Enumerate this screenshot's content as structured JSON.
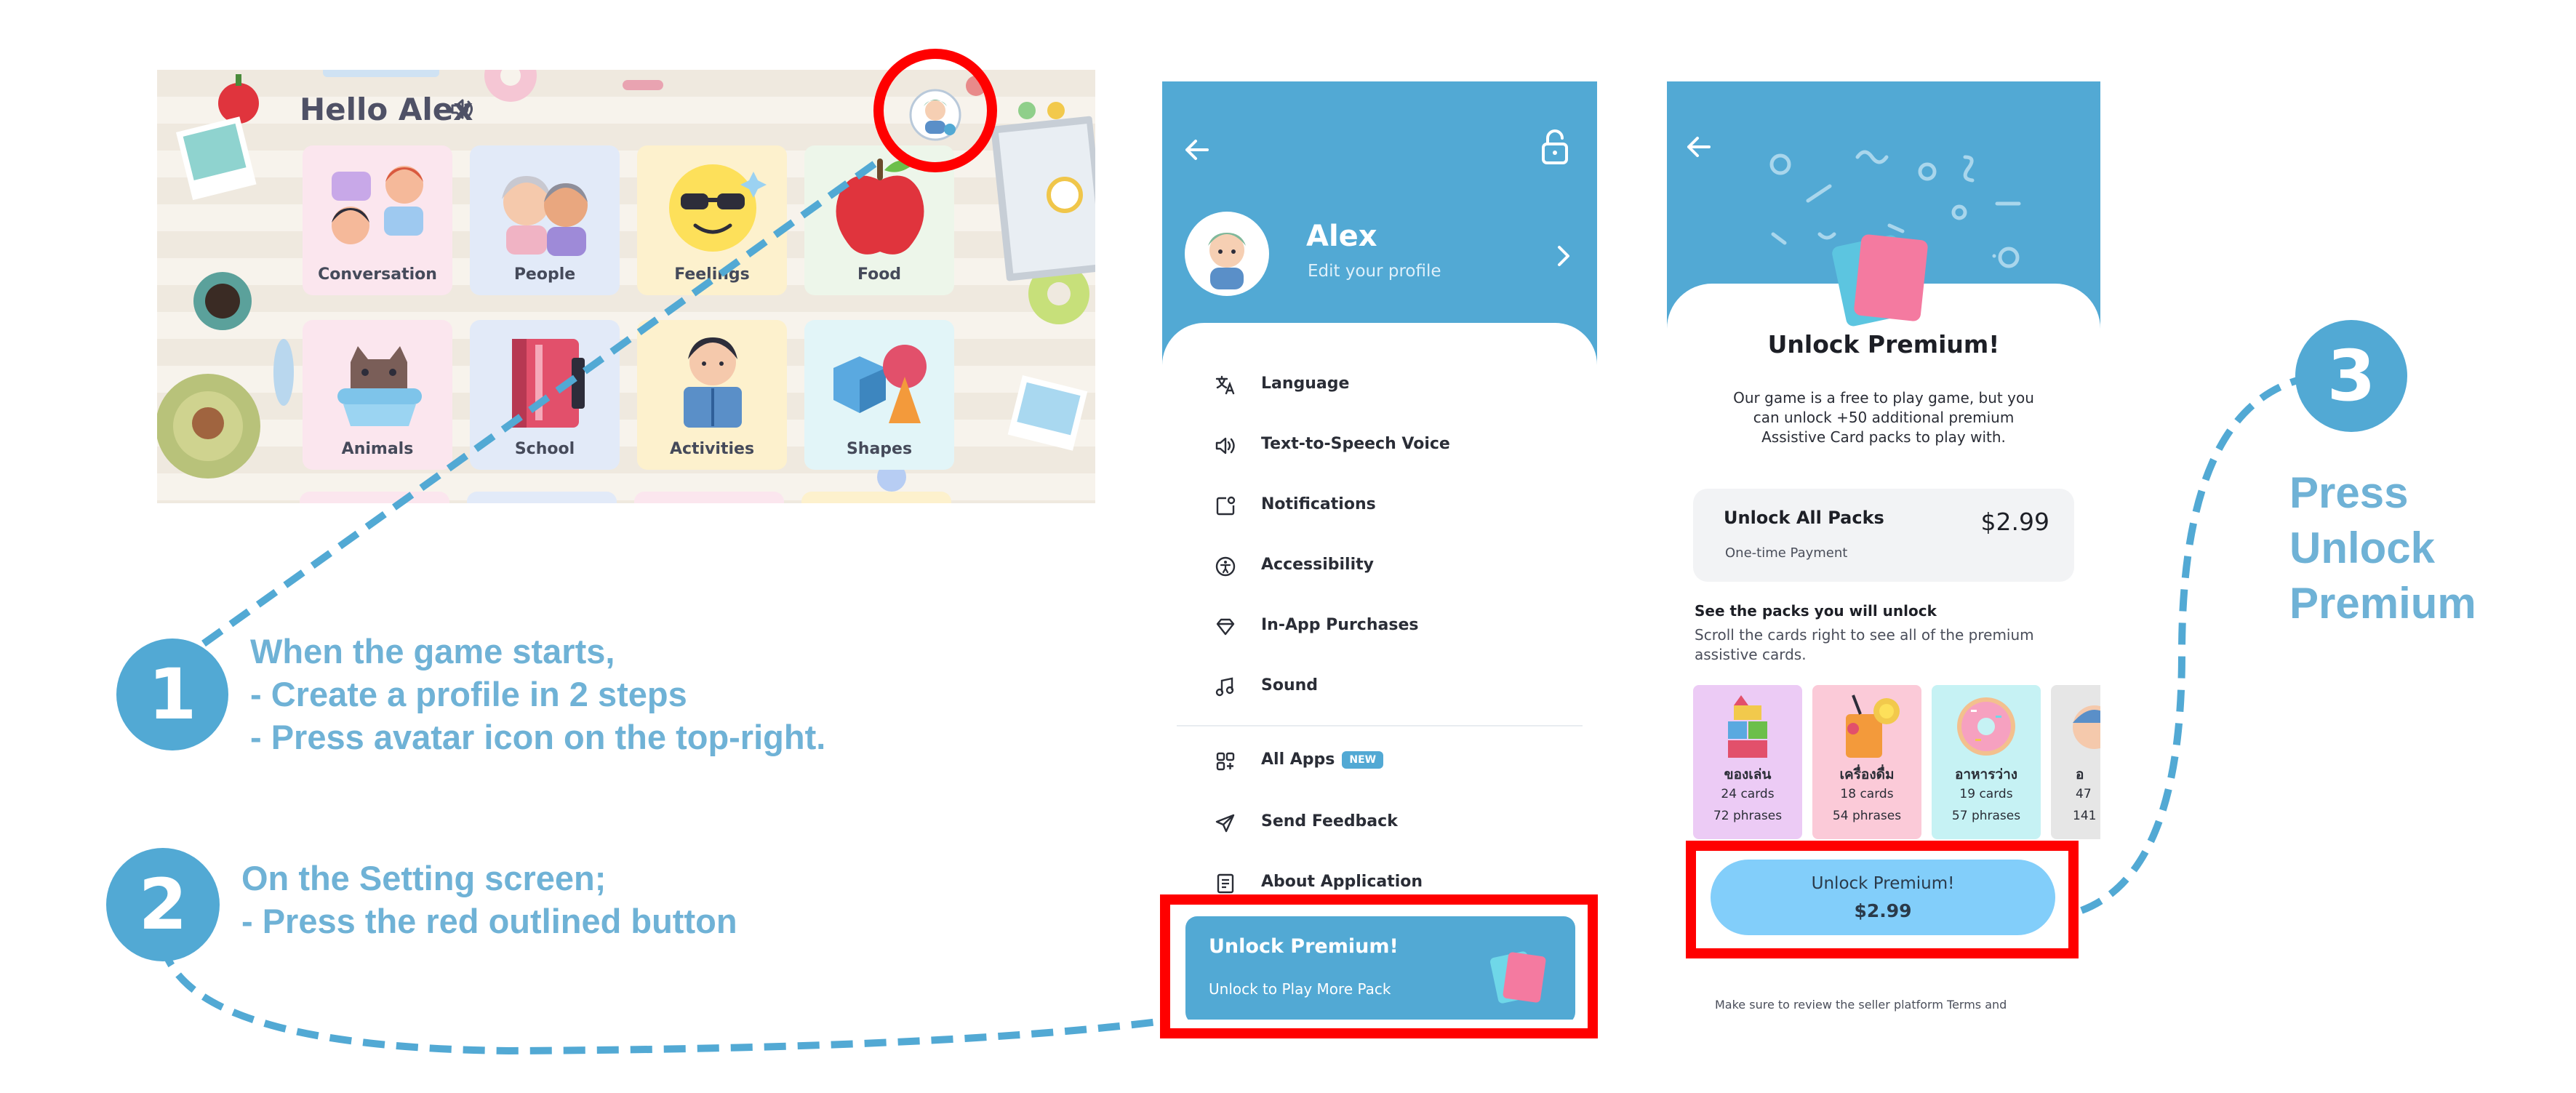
{
  "home": {
    "greeting": "Hello Alex",
    "tiles": [
      {
        "label": "Conversation",
        "color": "#fbe6ee"
      },
      {
        "label": "People",
        "color": "#e2eaf8"
      },
      {
        "label": "Feelings",
        "color": "#fdf1cd"
      },
      {
        "label": "Food",
        "color": "#edf6ea"
      },
      {
        "label": "Animals",
        "color": "#fbe6ee"
      },
      {
        "label": "School",
        "color": "#e2eaf8"
      },
      {
        "label": "Activities",
        "color": "#fdf1cd"
      },
      {
        "label": "Shapes",
        "color": "#e2f5f8"
      }
    ]
  },
  "settings": {
    "profile_name": "Alex",
    "profile_sub": "Edit your profile",
    "menu": [
      {
        "label": "Language",
        "icon": "translate-icon"
      },
      {
        "label": "Text-to-Speech Voice",
        "icon": "speaker-icon"
      },
      {
        "label": "Notifications",
        "icon": "notification-icon"
      },
      {
        "label": "Accessibility",
        "icon": "accessibility-icon"
      },
      {
        "label": "In-App Purchases",
        "icon": "diamond-icon"
      },
      {
        "label": "Sound",
        "icon": "music-icon"
      }
    ],
    "menu2": [
      {
        "label": "All Apps",
        "icon": "apps-icon",
        "badge": "NEW"
      },
      {
        "label": "Send Feedback",
        "icon": "send-icon"
      },
      {
        "label": "About Application",
        "icon": "document-icon"
      }
    ],
    "banner_title": "Unlock Premium!",
    "banner_sub": "Unlock to Play More Pack"
  },
  "premium": {
    "title": "Unlock Premium!",
    "description": "Our game is a free to play game, but you can unlock +50 additional premium Assistive Card packs to play with.",
    "offer_title": "Unlock All Packs",
    "offer_sub": "One-time Payment",
    "price": "$2.99",
    "see_title": "See the packs you will unlock",
    "see_sub": "Scroll the cards right to see all of the premium assistive cards.",
    "packs": [
      {
        "name": "ของเล่น",
        "cards": "24 cards",
        "phrases": "72 phrases",
        "color": "#eccbf5"
      },
      {
        "name": "เครื่องดื่ม",
        "cards": "18 cards",
        "phrases": "54 phrases",
        "color": "#fbcad8"
      },
      {
        "name": "อาหารว่าง",
        "cards": "19 cards",
        "phrases": "57 phrases",
        "color": "#c6f2f4"
      },
      {
        "name": "อ",
        "cards": "47",
        "phrases": "141",
        "color": "#e6e6e6"
      }
    ],
    "button_label": "Unlock Premium!",
    "button_price": "$2.99",
    "footer": "Make sure to review the seller platform Terms and"
  },
  "steps": [
    {
      "num": "1",
      "lines": [
        "When the game starts,",
        "- Create a profile in 2 steps",
        "- Press avatar icon on the top-right."
      ]
    },
    {
      "num": "2",
      "lines": [
        "On the Setting screen;",
        "- Press the red outlined button"
      ]
    },
    {
      "num": "3",
      "lines": [
        "Press",
        "Unlock",
        "Premium"
      ]
    }
  ],
  "colors": {
    "accent": "#52a9d4",
    "highlight": "#ff0000",
    "note_text": "#6fb2d6",
    "premium_button": "#82cefa"
  }
}
